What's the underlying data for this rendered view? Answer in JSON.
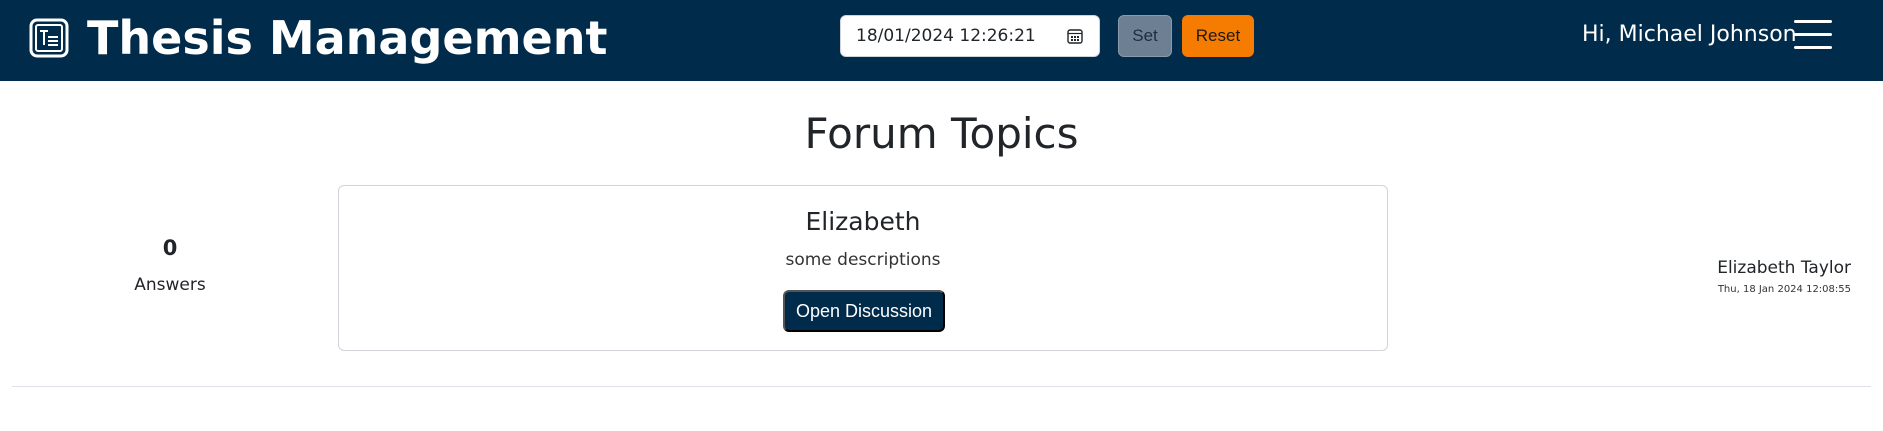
{
  "app": {
    "title": "Thesis Management",
    "brand_icon": "text-document-icon"
  },
  "toolbar": {
    "date_value": "18/01/2024 12:26:21",
    "calendar_icon": "calendar-icon",
    "set_label": "Set",
    "reset_label": "Reset"
  },
  "user": {
    "greeting": "Hi, Michael Johnson",
    "menu_icon": "hamburger-menu-icon"
  },
  "page": {
    "title": "Forum Topics"
  },
  "topics": [
    {
      "answers_count": "0",
      "answers_label": "Answers",
      "title": "Elizabeth",
      "description": "some descriptions",
      "open_label": "Open Discussion",
      "author": "Elizabeth Taylor",
      "timestamp": "Thu, 18 Jan 2024 12:08:55"
    }
  ],
  "colors": {
    "navbar": "#002b4a",
    "reset_button": "#f57c00",
    "set_button": "#6c7f93",
    "open_button": "#002b4a"
  }
}
